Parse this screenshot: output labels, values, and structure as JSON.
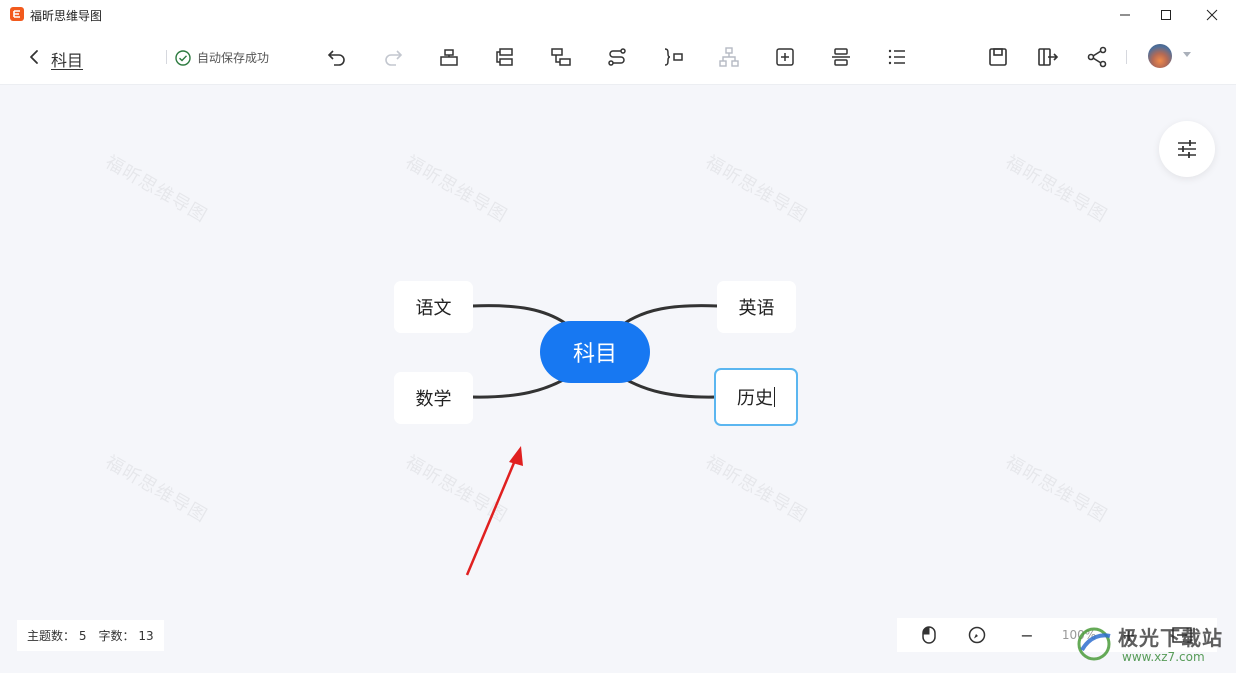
{
  "window": {
    "app_title": "福昕思维导图",
    "controls": [
      "minimize-icon",
      "maximize-icon",
      "close-icon"
    ]
  },
  "toolbar": {
    "doc_title": "科目",
    "save_status": "自动保存成功",
    "icons": [
      "undo-icon",
      "redo-icon",
      "add-topic-icon",
      "add-subtopic-icon",
      "add-sibling-icon",
      "connector-icon",
      "summary-icon",
      "structure-icon",
      "insert-icon",
      "align-icon",
      "list-icon",
      "save-icon",
      "export-icon",
      "share-icon"
    ]
  },
  "canvas": {
    "watermark": "福昕思维导图",
    "root": {
      "label": "科目",
      "color": "#1778f2"
    },
    "topics": [
      {
        "label": "语文",
        "side": "left"
      },
      {
        "label": "数学",
        "side": "left"
      },
      {
        "label": "英语",
        "side": "right"
      },
      {
        "label": "历史",
        "side": "right",
        "selected": true
      }
    ]
  },
  "status": {
    "topic_count_label": "主题数：",
    "topic_count": "5",
    "word_count_label": "字数：",
    "word_count": "13"
  },
  "zoom": {
    "level": "100%",
    "minus": "−",
    "plus": "+"
  },
  "site_watermark": {
    "text": "极光下载站",
    "url_text": "www.xz7.com"
  },
  "colors": {
    "accent": "#1778f2",
    "selection": "#5bb6f0",
    "arrow": "#e02020"
  }
}
